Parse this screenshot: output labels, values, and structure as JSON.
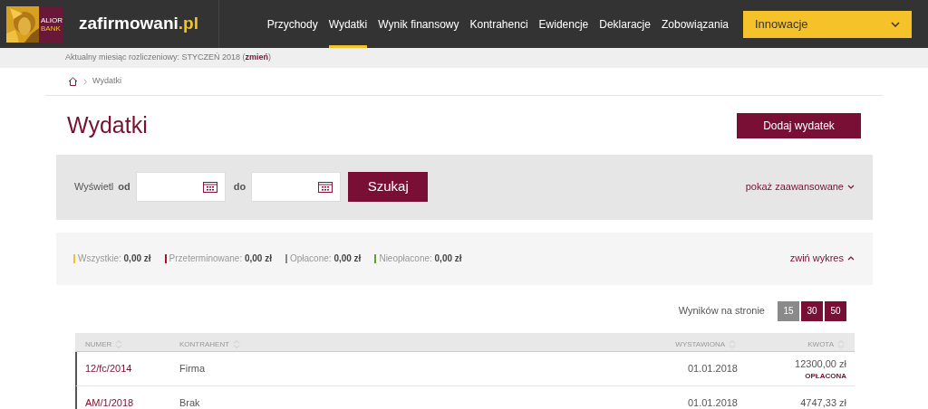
{
  "header": {
    "bank_logo": {
      "line_1": "ALIOR",
      "line_2": "BANK"
    },
    "site_name": "zafirmowani",
    "site_tld": ".pl",
    "nav": [
      {
        "label": "Przychody",
        "selected": false
      },
      {
        "label": "Wydatki",
        "selected": true
      },
      {
        "label": "Wynik finansowy",
        "selected": false
      },
      {
        "label": "Kontrahenci",
        "selected": false
      },
      {
        "label": "Ewidencje",
        "selected": false
      },
      {
        "label": "Deklaracje",
        "selected": false
      },
      {
        "label": "Zobowiązania",
        "selected": false
      }
    ],
    "dropdown": "Innowacje"
  },
  "period_bar": {
    "text": "Aktualny miesiąc rozliczeniowy: STYCZEŃ 2018 (",
    "link": "zmień",
    "close": ")"
  },
  "breadcrumb": [
    "Wydatki"
  ],
  "title": "Wydatki",
  "add_button": "Dodaj wydatek",
  "filter": {
    "label": "Wyświetl",
    "from_label": "od",
    "to_label": "do",
    "search_button": "Szukaj",
    "advanced_link": "pokaż zaawansowane"
  },
  "summary": {
    "items": [
      {
        "label": "Wszystkie:",
        "value": "0,00 zł",
        "color": "#f0c030"
      },
      {
        "label": "Przeterminowane:",
        "value": "0,00 zł",
        "color": "#b01030"
      },
      {
        "label": "Opłacone:",
        "value": "0,00 zł",
        "color": "#888888"
      },
      {
        "label": "Nieopłacone:",
        "value": "0,00 zł",
        "color": "#60a030"
      }
    ],
    "toggle_link": "zwiń wykres"
  },
  "per_page": {
    "label": "Wyników na stronie",
    "options": [
      {
        "label": "15",
        "selected": true
      },
      {
        "label": "30",
        "selected": false
      },
      {
        "label": "50",
        "selected": false
      }
    ]
  },
  "table": {
    "columns": [
      "NUMER",
      "KONTRAHENT",
      "WYSTAWIONA",
      "KWOTA"
    ],
    "rows": [
      {
        "number": "12/fc/2014",
        "contractor": "Firma",
        "issued": "01.01.2018",
        "amount": "12300,00 zł",
        "status": "OPŁACONA"
      },
      {
        "number": "AM/1/2018",
        "contractor": "Brak",
        "issued": "01.01.2018",
        "amount": "4747,33 zł"
      }
    ]
  }
}
